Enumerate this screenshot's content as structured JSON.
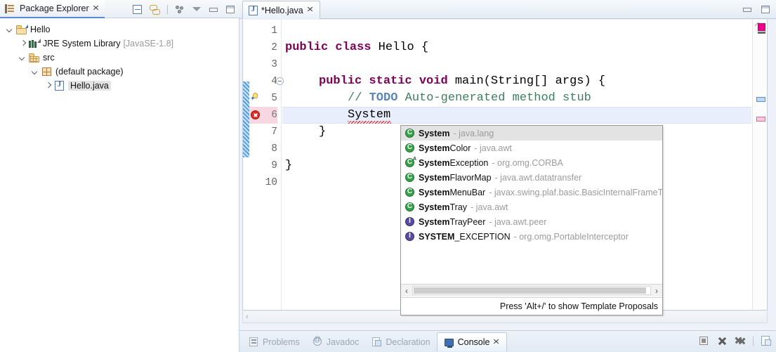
{
  "explorer": {
    "tab_title": "Package Explorer",
    "close_icon": "✕",
    "toolbar": [
      {
        "name": "collapse-all-icon",
        "title": "Collapse All"
      },
      {
        "name": "link-with-editor-icon",
        "title": "Link with Editor"
      },
      {
        "name": "view-menu-dots-icon",
        "title": "View Menu"
      },
      {
        "name": "chevron-down-icon",
        "title": "View Menu"
      },
      {
        "name": "minimize-icon",
        "title": "Minimize"
      },
      {
        "name": "maximize-icon",
        "title": "Maximize"
      }
    ],
    "tree": [
      {
        "label": "Hello",
        "dim": "",
        "depth": 0,
        "arrow": "open",
        "icon": "project-folder-icon",
        "selected": false
      },
      {
        "label": "JRE System Library",
        "dim": "[JavaSE-1.8]",
        "depth": 1,
        "arrow": "closed",
        "icon": "library-icon",
        "selected": false
      },
      {
        "label": "src",
        "dim": "",
        "depth": 1,
        "arrow": "open",
        "icon": "source-folder-icon",
        "selected": false
      },
      {
        "label": "(default package)",
        "dim": "",
        "depth": 2,
        "arrow": "open",
        "icon": "package-icon",
        "selected": false
      },
      {
        "label": "Hello.java",
        "dim": "",
        "depth": 3,
        "arrow": "closed",
        "icon": "java-file-icon",
        "selected": true
      }
    ]
  },
  "editor": {
    "tab_title": "*Hello.java",
    "close_icon": "✕",
    "window_buttons": [
      {
        "name": "minimize-icon",
        "title": "Minimize"
      },
      {
        "name": "maximize-icon",
        "title": "Maximize"
      }
    ],
    "line_numbers": [
      "1",
      "2",
      "3",
      "4",
      "5",
      "6",
      "7",
      "8",
      "9",
      "10"
    ],
    "error_line": 6,
    "lines": [
      {
        "n": 1,
        "indent": 0,
        "segments": []
      },
      {
        "n": 2,
        "indent": 0,
        "segments": [
          {
            "t": "public",
            "c": "kw"
          },
          {
            "t": " ",
            "c": ""
          },
          {
            "t": "class",
            "c": "kw"
          },
          {
            "t": " Hello {",
            "c": ""
          }
        ]
      },
      {
        "n": 3,
        "indent": 0,
        "segments": []
      },
      {
        "n": 4,
        "indent": 2,
        "segments": [
          {
            "t": "public",
            "c": "kw"
          },
          {
            "t": " ",
            "c": ""
          },
          {
            "t": "static",
            "c": "kw"
          },
          {
            "t": " ",
            "c": ""
          },
          {
            "t": "void",
            "c": "kw"
          },
          {
            "t": " main(String[] args) {",
            "c": ""
          }
        ]
      },
      {
        "n": 5,
        "indent": 4,
        "segments": [
          {
            "t": "// ",
            "c": "cm"
          },
          {
            "t": "TODO",
            "c": "todo"
          },
          {
            "t": " Auto-generated method stub",
            "c": "cm"
          }
        ]
      },
      {
        "n": 6,
        "indent": 4,
        "segments": [
          {
            "t": "System",
            "c": ""
          }
        ]
      },
      {
        "n": 7,
        "indent": 2,
        "segments": [
          {
            "t": "}",
            "c": ""
          }
        ]
      },
      {
        "n": 8,
        "indent": 0,
        "segments": []
      },
      {
        "n": 9,
        "indent": 0,
        "segments": [
          {
            "t": "}",
            "c": ""
          }
        ]
      },
      {
        "n": 10,
        "indent": 0,
        "segments": []
      }
    ]
  },
  "popup": {
    "footer_hint": "Press 'Alt+/' to show Template Proposals",
    "hscroll_left_icon": "‹",
    "hscroll_right_icon": "›",
    "proposals": [
      {
        "kind": "class",
        "name": "System",
        "prefix": "System",
        "tail": "",
        "pkg": "- java.lang",
        "selected": true,
        "deprecated": false
      },
      {
        "kind": "class",
        "name": "SystemColor",
        "prefix": "System",
        "tail": "Color",
        "pkg": "- java.awt",
        "selected": false,
        "deprecated": false
      },
      {
        "kind": "class",
        "name": "SystemException",
        "prefix": "System",
        "tail": "Exception",
        "pkg": "- org.omg.CORBA",
        "selected": false,
        "deprecated": false
      },
      {
        "kind": "class",
        "name": "SystemFlavorMap",
        "prefix": "System",
        "tail": "FlavorMap",
        "pkg": "- java.awt.datatransfer",
        "selected": false,
        "deprecated": false
      },
      {
        "kind": "class",
        "name": "SystemMenuBar",
        "prefix": "System",
        "tail": "MenuBar",
        "pkg": "- javax.swing.plaf.basic.BasicInternalFrameT",
        "selected": false,
        "deprecated": false
      },
      {
        "kind": "class",
        "name": "SystemTray",
        "prefix": "System",
        "tail": "Tray",
        "pkg": "- java.awt",
        "selected": false,
        "deprecated": false
      },
      {
        "kind": "interface",
        "name": "SystemTrayPeer",
        "prefix": "System",
        "tail": "TrayPeer",
        "pkg": "- java.awt.peer",
        "selected": false,
        "deprecated": false
      },
      {
        "kind": "interface",
        "name": "SYSTEM_EXCEPTION",
        "prefix": "SYSTEM",
        "tail": "_EXCEPTION",
        "pkg": "- org.omg.PortableInterceptor",
        "selected": false,
        "deprecated": false
      }
    ]
  },
  "bottom_panel": {
    "tabs": [
      {
        "label": "Problems",
        "icon": "problems-icon",
        "active": false
      },
      {
        "label": "Javadoc",
        "icon": "javadoc-icon",
        "active": false
      },
      {
        "label": "Declaration",
        "icon": "declaration-icon",
        "active": false
      },
      {
        "label": "Console",
        "icon": "console-icon",
        "active": true
      }
    ],
    "close_icon": "✕",
    "toolbar": [
      {
        "name": "terminate-icon",
        "title": "Terminate"
      },
      {
        "name": "remove-console-icon",
        "title": "Remove Launch"
      },
      {
        "name": "remove-all-icon",
        "title": "Remove All Terminated Launches"
      },
      {
        "name": "open-console-icon",
        "title": "Open Console"
      }
    ]
  },
  "colors": {
    "keyword": "#7f0055",
    "comment": "#3f7f5f",
    "todo": "#5a87b5",
    "selection": "#e3e3e3",
    "current_line": "#e8eefb",
    "error": "#d93025",
    "tab_underline": "#5a8ad6"
  }
}
